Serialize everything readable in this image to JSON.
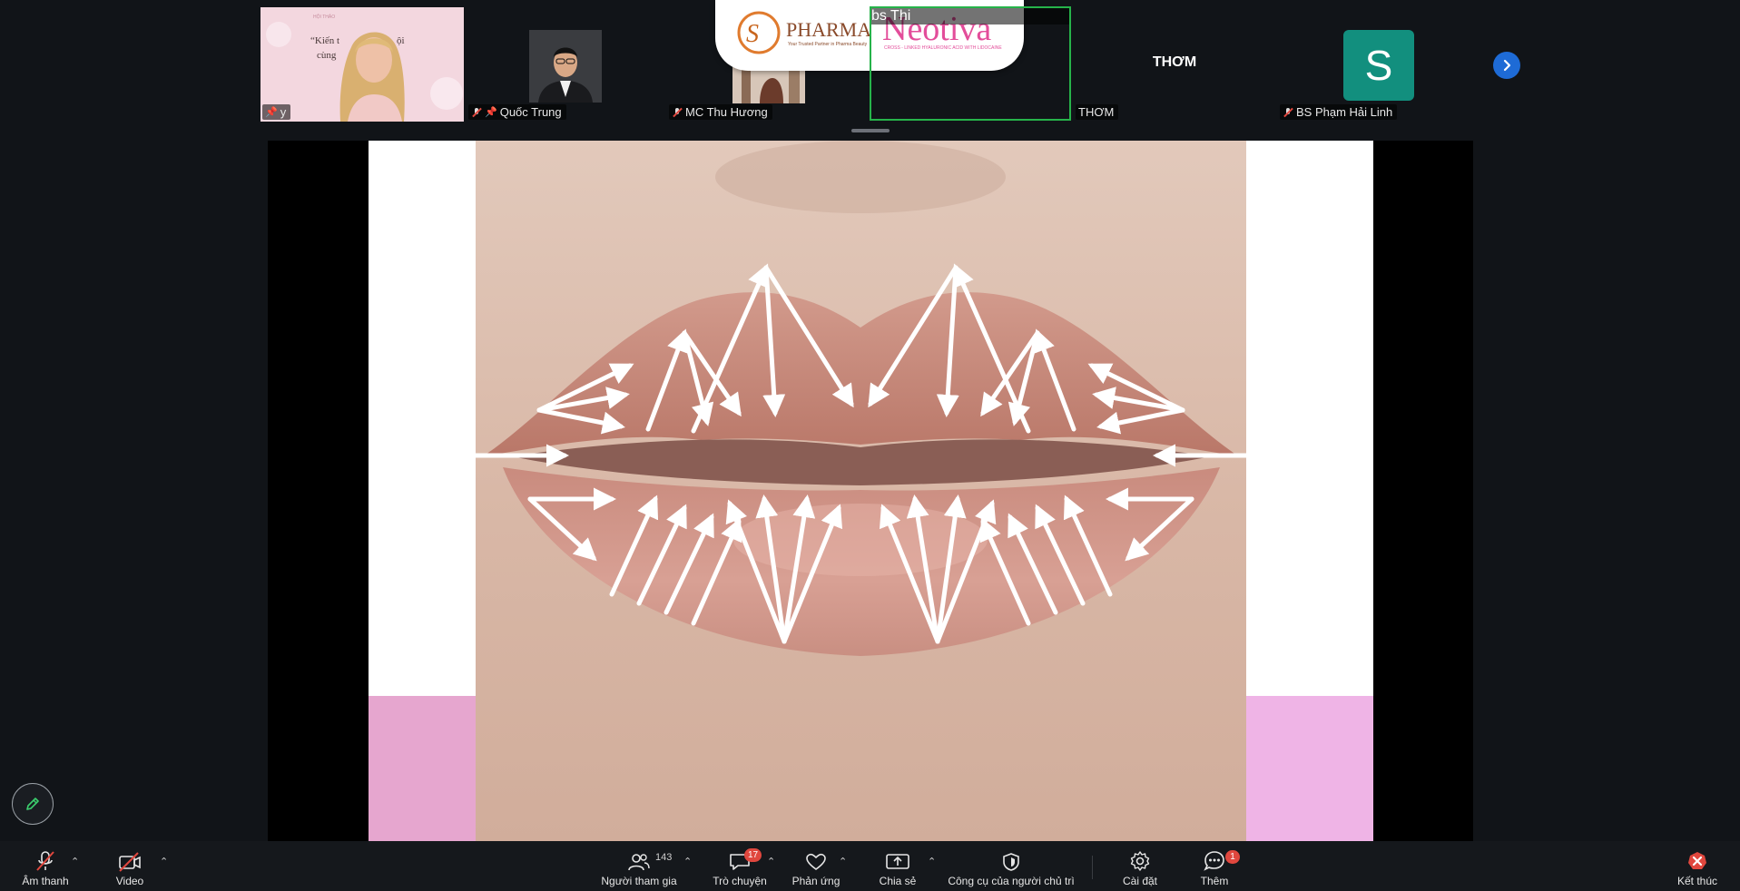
{
  "participants": [
    {
      "name": "y",
      "pinned": true,
      "muted": false,
      "has_video": true
    },
    {
      "name": "Quốc Trung",
      "pinned": true,
      "muted": true,
      "has_video": true
    },
    {
      "name": "MC Thu Hương",
      "pinned": false,
      "muted": true,
      "has_video": true
    },
    {
      "name": "bs Thi",
      "pinned": false,
      "muted": false,
      "has_video": false,
      "active_speaker": true
    },
    {
      "name": "THƠM",
      "pinned": false,
      "muted": false,
      "has_video": false,
      "display_text": "THƠM"
    },
    {
      "name": "BS Phạm Hải Linh",
      "pinned": false,
      "muted": true,
      "has_video": false,
      "avatar_letter": "S"
    }
  ],
  "slide_thumb_text": {
    "line1": "“Kiến t",
    "line2": "cùng",
    "line3": "ội"
  },
  "logos": {
    "pharma": "PHARMA",
    "pharma_tagline": "Your Trusted Partner in Pharma Beauty",
    "neotiva": "Neotiva",
    "neotiva_tagline": "CROSS - LINKED HYALURONIC ACID WITH LIDOCAINE"
  },
  "toolbar": {
    "audio": "Âm thanh",
    "video": "Video",
    "participants": "Người tham gia",
    "participants_count": "143",
    "chat": "Trò chuyện",
    "chat_badge": "17",
    "reactions": "Phản ứng",
    "share": "Chia sẻ",
    "host_tools": "Công cụ của người chủ trì",
    "settings": "Cài đặt",
    "more": "Thêm",
    "more_badge": "1",
    "end": "Kết thúc"
  },
  "colors": {
    "accent_green": "#26b34a",
    "avatar_teal": "#128f7e",
    "next_blue": "#1e6bd6",
    "badge_red": "#e0473e"
  }
}
